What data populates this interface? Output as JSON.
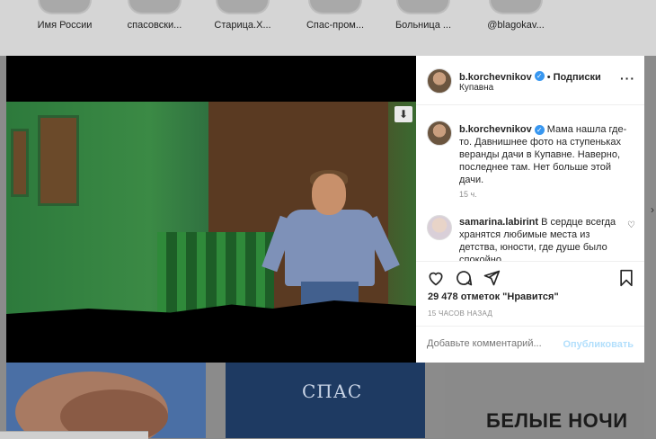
{
  "highlights": [
    "Имя России",
    "спасовски...",
    "Старица.Х...",
    "Спас-пром...",
    "Больница ...",
    "@blagokav..."
  ],
  "background_tiles": {
    "tile2_logo": "СПАС",
    "tile3_text": "БЕЛЫЕ НОЧИ"
  },
  "post": {
    "username": "b.korchevnikov",
    "follow_label": "Подписки",
    "dot": "•",
    "location": "Купавна",
    "more_icon": "more-horizontal-icon",
    "caption": "Мама нашла где-то. Давнишнее фото на ступеньках веранды дачи в Купавне. Наверно, последнее там. Нет больше этой дачи.",
    "caption_time": "15 ч.",
    "comment": {
      "username": "samarina.labirint",
      "text": "В сердце всегда хранятся любимые места из детства, юности, где душе было спокойно..."
    },
    "likes": "29 478 отметок \"Нравится\"",
    "time_ago": "15 ЧАСОВ НАЗАД",
    "comment_placeholder": "Добавьте комментарий...",
    "publish_label": "Опубликовать"
  },
  "colors": {
    "verified": "#3897f0",
    "publish": "#b2dffc"
  }
}
